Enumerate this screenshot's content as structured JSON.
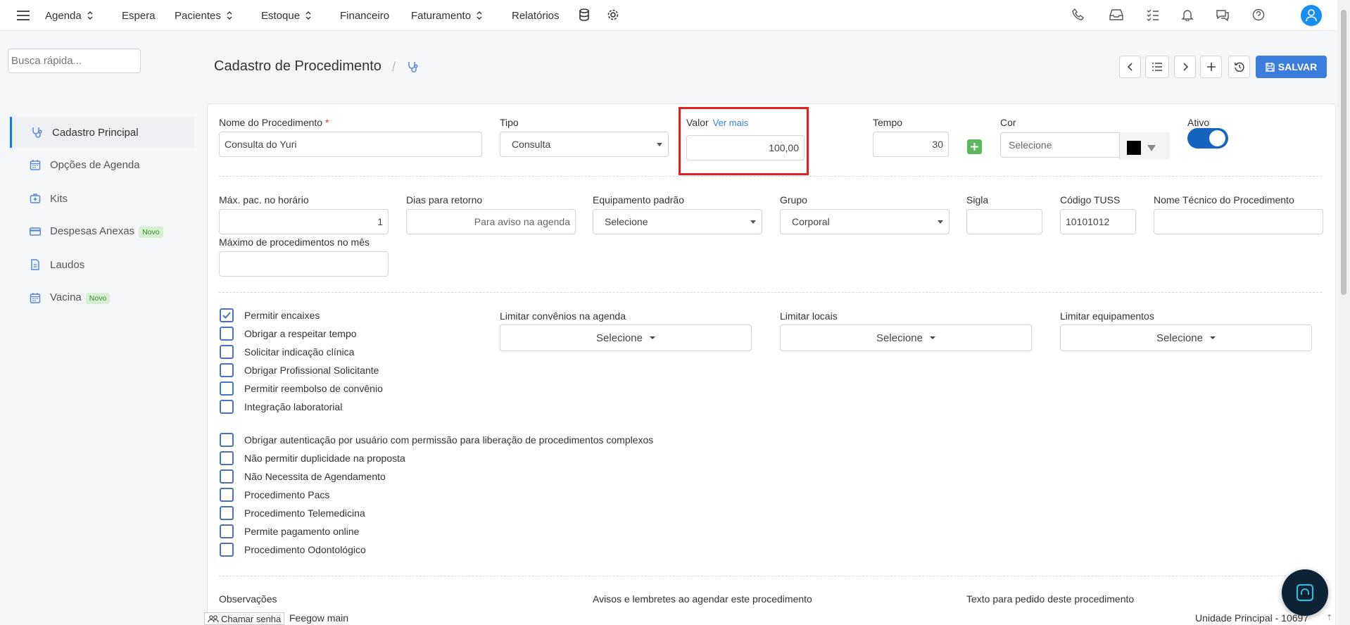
{
  "nav": {
    "items": [
      {
        "label": "Agenda"
      },
      {
        "label": "Espera"
      },
      {
        "label": "Pacientes"
      },
      {
        "label": "Estoque"
      },
      {
        "label": "Financeiro"
      },
      {
        "label": "Faturamento"
      },
      {
        "label": "Relatórios"
      }
    ]
  },
  "search": {
    "placeholder": "Busca rápida..."
  },
  "sidebar": {
    "items": [
      {
        "label": "Cadastro Principal",
        "icon": "stethoscope-icon",
        "active": true
      },
      {
        "label": "Opções de Agenda",
        "icon": "calendar-icon"
      },
      {
        "label": "Kits",
        "icon": "medkit-icon"
      },
      {
        "label": "Despesas Anexas",
        "icon": "credit-card-icon",
        "badge": "Novo"
      },
      {
        "label": "Laudos",
        "icon": "document-icon"
      },
      {
        "label": "Vacina",
        "icon": "calendar-icon",
        "badge": "Novo"
      }
    ]
  },
  "page": {
    "title": "Cadastro de Procedimento",
    "save_label": "SALVAR"
  },
  "form": {
    "nome": {
      "label": "Nome do Procedimento",
      "required": "*",
      "value": "Consulta do Yuri"
    },
    "tipo": {
      "label": "Tipo",
      "value": "Consulta"
    },
    "valor": {
      "label": "Valor",
      "link": "Ver mais",
      "value": "100,00"
    },
    "tempo": {
      "label": "Tempo",
      "value": "30"
    },
    "cor": {
      "label": "Cor",
      "placeholder": "Selecione",
      "color": "#000000"
    },
    "ativo": {
      "label": "Ativo",
      "on": true
    },
    "max_pac": {
      "label": "Máx. pac. no horário",
      "value": "1"
    },
    "dias_retorno": {
      "label": "Dias para retorno",
      "placeholder": "Para aviso na agenda"
    },
    "equipamento": {
      "label": "Equipamento padrão",
      "value": "Selecione"
    },
    "grupo": {
      "label": "Grupo",
      "value": "Corporal"
    },
    "sigla": {
      "label": "Sigla",
      "value": ""
    },
    "tuss": {
      "label": "Código TUSS",
      "value": "10101012"
    },
    "nome_tecnico": {
      "label": "Nome Técnico do Procedimento",
      "value": ""
    },
    "max_mes": {
      "label": "Máximo de procedimentos no mês",
      "value": ""
    }
  },
  "checks_a": [
    {
      "label": "Permitir encaixes",
      "checked": true
    },
    {
      "label": "Obrigar a respeitar tempo",
      "checked": false
    },
    {
      "label": "Solicitar indicação clínica",
      "checked": false
    },
    {
      "label": "Obrigar Profissional Solicitante",
      "checked": false
    },
    {
      "label": "Permitir reembolso de convênio",
      "checked": false
    },
    {
      "label": "Integração laboratorial",
      "checked": false
    }
  ],
  "checks_b": [
    {
      "label": "Obrigar autenticação por usuário com permissão para liberação de procedimentos complexos",
      "checked": false
    },
    {
      "label": "Não permitir duplicidade na proposta",
      "checked": false
    },
    {
      "label": "Não Necessita de Agendamento",
      "checked": false
    },
    {
      "label": "Procedimento Pacs",
      "checked": false
    },
    {
      "label": "Procedimento Telemedicina",
      "checked": false
    },
    {
      "label": "Permite pagamento online",
      "checked": false
    },
    {
      "label": "Procedimento Odontológico",
      "checked": false
    }
  ],
  "limits": [
    {
      "label": "Limitar convênios na agenda",
      "value": "Selecione"
    },
    {
      "label": "Limitar locais",
      "value": "Selecione"
    },
    {
      "label": "Limitar equipamentos",
      "value": "Selecione"
    }
  ],
  "bottom_labels": [
    "Observações",
    "Avisos e lembretes ao agendar este procedimento",
    "Texto para pedido deste procedimento"
  ],
  "footer": {
    "chamar": "Chamar senha",
    "branch": "Feegow main",
    "unit": "Unidade Principal - 10697"
  },
  "colors": {
    "accent": "#3b7ddd",
    "toggle": "#1565c0",
    "highlight": "#e02020",
    "plus": "#5cb85c"
  }
}
